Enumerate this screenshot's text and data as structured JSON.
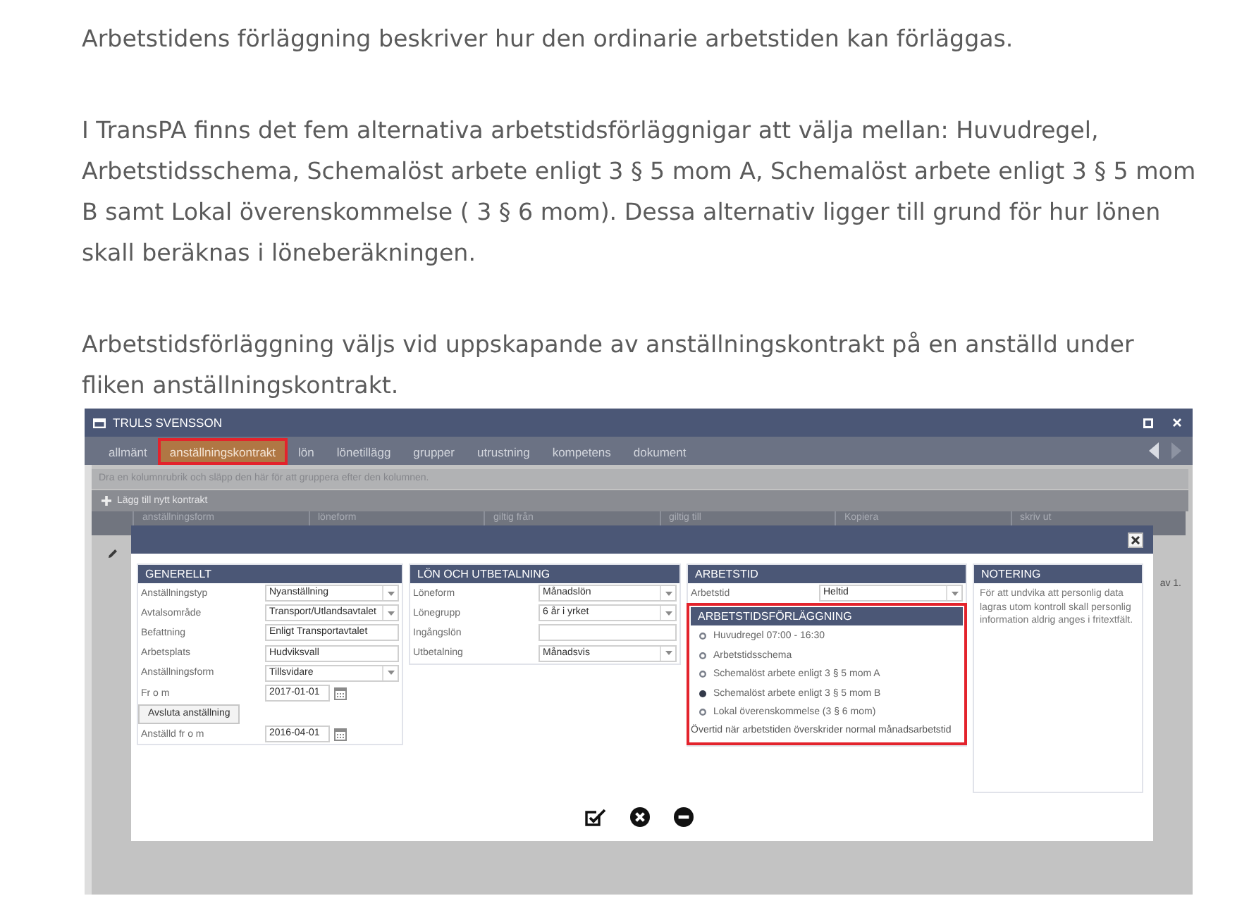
{
  "paragraphs": [
    "Arbetstidens förläggning beskriver hur den ordinarie arbetstiden kan förläggas.",
    "I TransPA finns det fem alternativa arbetstidsförläggnigar att välja mellan: Huvudregel, Arbetstidsschema, Schemalöst arbete enligt 3 § 5 mom A, Schemalöst arbete enligt 3 § 5 mom B samt Lokal överenskommelse ( 3 § 6 mom). Dessa alternativ ligger till grund för hur lönen skall beräknas i löneberäkningen.",
    "Arbetstidsförläggning väljs vid uppskapande av anställningskontrakt på en anställd under fliken anställningskontrakt."
  ],
  "app_window": {
    "title": "TRULS SVENSSON",
    "tabs": [
      {
        "label": "allmänt",
        "selected": false,
        "highlighted": false
      },
      {
        "label": "anställningskontrakt",
        "selected": true,
        "highlighted": true
      },
      {
        "label": "lön",
        "selected": false,
        "highlighted": false
      },
      {
        "label": "lönetillägg",
        "selected": false,
        "highlighted": false
      },
      {
        "label": "grupper",
        "selected": false,
        "highlighted": false
      },
      {
        "label": "utrustning",
        "selected": false,
        "highlighted": false
      },
      {
        "label": "kompetens",
        "selected": false,
        "highlighted": false
      },
      {
        "label": "dokument",
        "selected": false,
        "highlighted": false
      }
    ],
    "grid": {
      "group_hint": "Dra en kolumnrubrik och släpp den här för att gruppera efter den kolumnen.",
      "add_button": "Lägg till nytt kontrakt",
      "columns": [
        "anställningsform",
        "löneform",
        "giltig från",
        "giltig till",
        "Kopiera",
        "skriv ut"
      ],
      "pager": "av 1."
    },
    "dialog": {
      "sections": [
        {
          "kind": "form",
          "title": "GENERELLT",
          "fields": [
            {
              "kind": "select",
              "label": "Anställningstyp",
              "value": "Nyanställning"
            },
            {
              "kind": "select",
              "label": "Avtalsområde",
              "value": "Transport/Utlandsavtalet"
            },
            {
              "kind": "text",
              "label": "Befattning",
              "value": "Enligt Transportavtalet"
            },
            {
              "kind": "text",
              "label": "Arbetsplats",
              "value": "Hudviksvall"
            },
            {
              "kind": "select",
              "label": "Anställningsform",
              "value": "Tillsvidare"
            },
            {
              "kind": "date",
              "label": "Fr o m",
              "value": "2017-01-01"
            },
            {
              "kind": "button",
              "label": "Avsluta anställning"
            },
            {
              "kind": "date",
              "label": "Anställd fr o m",
              "value": "2016-04-01"
            }
          ]
        },
        {
          "kind": "form",
          "title": "LÖN OCH UTBETALNING",
          "fields": [
            {
              "kind": "select",
              "label": "Löneform",
              "value": "Månadslön"
            },
            {
              "kind": "select",
              "label": "Lönegrupp",
              "value": "6 år i yrket"
            },
            {
              "kind": "text",
              "label": "Ingångslön"
            },
            {
              "kind": "select",
              "label": "Utbetalning",
              "value": "Månadsvis"
            }
          ]
        },
        {
          "kind": "form",
          "title": "ARBETSTID",
          "fields": [
            {
              "kind": "select",
              "label": "Arbetstid",
              "value": "Heltid"
            }
          ],
          "placement": {
            "title": "ARBETSTIDSFÖRLÄGGNING",
            "highlighted": true,
            "options": [
              {
                "label": "Huvudregel 07:00 - 16:30",
                "selected": false
              },
              {
                "label": "Arbetstidsschema",
                "selected": false
              },
              {
                "label": "Schemalöst arbete enligt 3 § 5 mom A",
                "selected": false
              },
              {
                "label": "Schemalöst arbete enligt 3 § 5 mom B",
                "selected": true
              },
              {
                "label": "Lokal överenskommelse (3 § 6 mom)",
                "selected": false
              }
            ],
            "note": "Övertid när arbetstiden överskrider normal månadsarbetstid"
          }
        },
        {
          "kind": "note",
          "title": "NOTERING",
          "text": "För att undvika att personlig data lagras utom kontroll skall personlig information aldrig anges i fritextfält."
        }
      ]
    }
  }
}
